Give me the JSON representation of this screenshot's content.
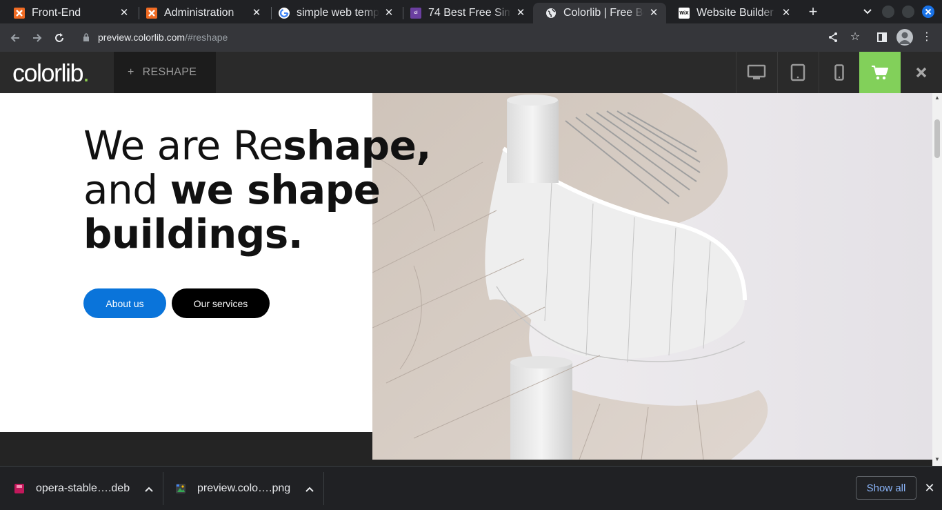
{
  "browser": {
    "tabs": [
      {
        "title": "Front-End",
        "favicon": "xampp-icon",
        "color": "#f06b23"
      },
      {
        "title": "Administration",
        "favicon": "xampp-icon",
        "color": "#f06b23"
      },
      {
        "title": "simple web templa",
        "favicon": "google-icon",
        "color": "#ffffff"
      },
      {
        "title": "74 Best Free Simple",
        "favicon": "colorlib-icon",
        "color": "#6b3fa0"
      },
      {
        "title": "Colorlib | Free Boo",
        "favicon": "globe-icon",
        "color": "#e8eaed",
        "active": true
      },
      {
        "title": "Website Builder - C",
        "favicon": "wix-icon",
        "color": "#ffffff"
      }
    ],
    "url_host": "preview.colorlib.com",
    "url_path": "/#reshape"
  },
  "colorlib_bar": {
    "logo_text": "colorlib",
    "logo_dot": ".",
    "theme_label": "RESHAPE",
    "plus": "+",
    "devices": [
      "desktop-icon",
      "tablet-icon",
      "mobile-icon"
    ],
    "cart_color": "#82d05a"
  },
  "hero": {
    "line1_light": "We are Re",
    "line1_bold": "shape,",
    "line2_light": "and ",
    "line2_bold": "we shape",
    "line3_bold": "buildings.",
    "about_button": "About us",
    "services_button": "Our services",
    "about_color": "#0a74da",
    "services_color": "#000000"
  },
  "downloads": {
    "items": [
      {
        "name": "opera-stable….deb",
        "icon": "deb-package-icon"
      },
      {
        "name": "preview.colo….png",
        "icon": "image-file-icon"
      }
    ],
    "show_all": "Show all"
  }
}
